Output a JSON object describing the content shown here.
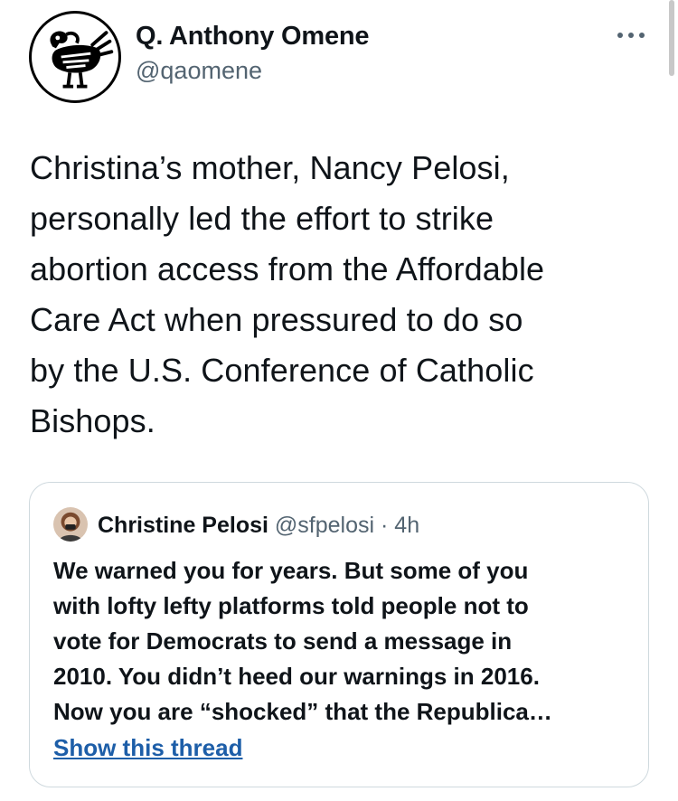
{
  "tweet": {
    "author": {
      "name": "Q. Anthony Omene",
      "handle": "@qaomene",
      "avatar_icon": "sankofa-bird-icon"
    },
    "more_icon": "more-horizontal-icon",
    "text": "Christina’s mother, Nancy Pelosi,\npersonally led the effort to strike\nabortion access from the Affordable\nCare Act when pressured to do so\nby the U.S. Conference of Catholic\nBishops."
  },
  "quoted_tweet": {
    "author": {
      "name": "Christine Pelosi",
      "handle": "@sfpelosi",
      "separator": "·",
      "time": "4h"
    },
    "text": "We warned you for years. But some of you\nwith lofty lefty platforms told people not to\nvote for Democrats to send a message in\n2010. You didn’t heed our warnings in 2016.\nNow you are “shocked” that the Republica…",
    "show_thread_label": "Show this thread"
  },
  "colors": {
    "text_primary": "#0f1419",
    "text_secondary": "#536471",
    "link": "#1d5ea8",
    "border": "#cfd9de"
  }
}
